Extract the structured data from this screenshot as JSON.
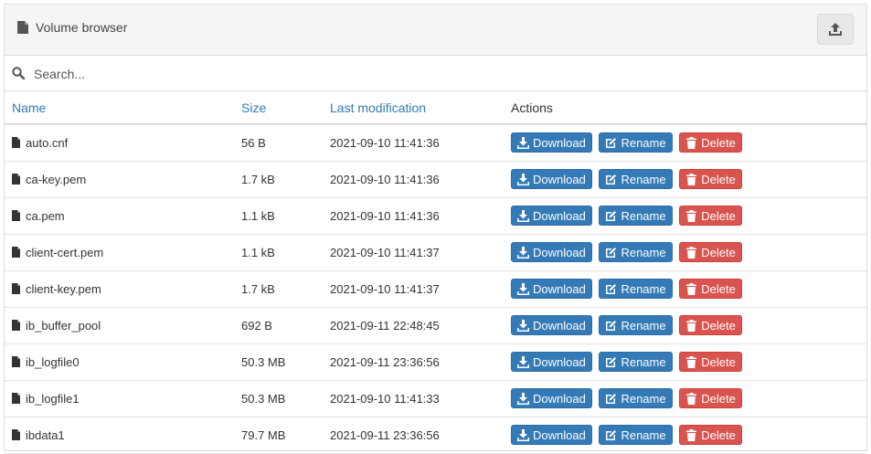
{
  "header": {
    "title": "Volume browser",
    "upload_icon": "upload-icon",
    "file_icon": "file-icon"
  },
  "search": {
    "placeholder": "Search...",
    "value": "",
    "icon": "search-icon"
  },
  "columns": {
    "name": "Name",
    "size": "Size",
    "modified": "Last modification",
    "actions": "Actions"
  },
  "actions": {
    "download": "Download",
    "rename": "Rename",
    "delete": "Delete"
  },
  "colors": {
    "primary": "#337ab7",
    "danger": "#d9534f",
    "link": "#337ab7"
  },
  "files": [
    {
      "name": "auto.cnf",
      "size": "56 B",
      "modified": "2021-09-10 11:41:36"
    },
    {
      "name": "ca-key.pem",
      "size": "1.7 kB",
      "modified": "2021-09-10 11:41:36"
    },
    {
      "name": "ca.pem",
      "size": "1.1 kB",
      "modified": "2021-09-10 11:41:36"
    },
    {
      "name": "client-cert.pem",
      "size": "1.1 kB",
      "modified": "2021-09-10 11:41:37"
    },
    {
      "name": "client-key.pem",
      "size": "1.7 kB",
      "modified": "2021-09-10 11:41:37"
    },
    {
      "name": "ib_buffer_pool",
      "size": "692 B",
      "modified": "2021-09-11 22:48:45"
    },
    {
      "name": "ib_logfile0",
      "size": "50.3 MB",
      "modified": "2021-09-11 23:36:56"
    },
    {
      "name": "ib_logfile1",
      "size": "50.3 MB",
      "modified": "2021-09-10 11:41:33"
    },
    {
      "name": "ibdata1",
      "size": "79.7 MB",
      "modified": "2021-09-11 23:36:56"
    }
  ]
}
